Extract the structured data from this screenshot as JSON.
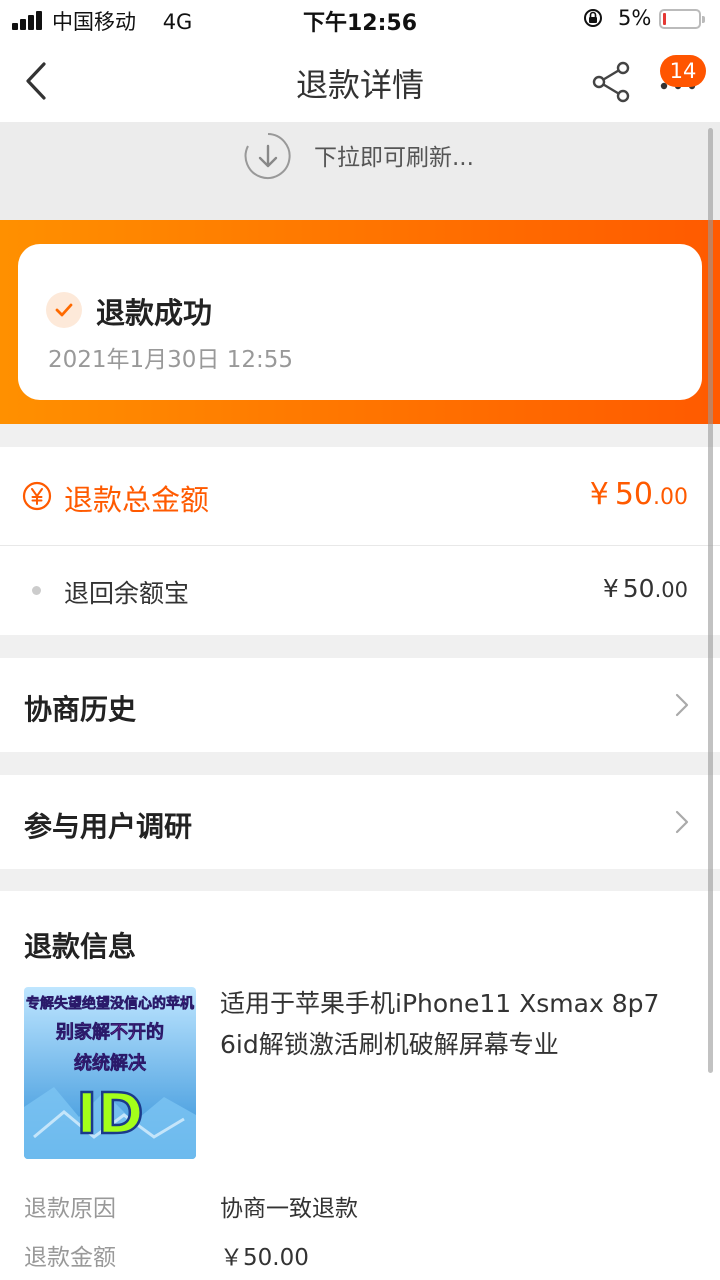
{
  "status_bar": {
    "carrier": "中国移动",
    "network": "4G",
    "time": "下午12:56",
    "battery_percent": "5%",
    "battery_level": 0.05
  },
  "nav": {
    "title": "退款详情",
    "badge_count": "14",
    "icons": [
      "back-icon",
      "share-icon",
      "more-icon"
    ]
  },
  "refresh": {
    "hint": "下拉即可刷新..."
  },
  "status_card": {
    "title": "退款成功",
    "time": "2021年1月30日 12:55"
  },
  "amount": {
    "total_label": "退款总金额",
    "total_currency": "¥",
    "total_int": "50",
    "total_dec": ".00",
    "sub_label": "退回余额宝",
    "sub_currency": "¥",
    "sub_int": "50",
    "sub_dec": ".00"
  },
  "links": [
    {
      "label": "协商历史"
    },
    {
      "label": "参与用户调研"
    }
  ],
  "refund_info": {
    "title": "退款信息",
    "product_image_text": [
      "专解失望绝望没信心的苹机",
      "别家解不开的",
      "统统解决",
      "ID"
    ],
    "product_title": "适用于苹果手机iPhone11 Xsmax 8p7 6id解锁激活刷机破解屏幕专业",
    "rows": [
      {
        "label": "退款原因",
        "value": "协商一致退款"
      },
      {
        "label": "退款金额",
        "value": "￥50.00"
      }
    ]
  },
  "colors": {
    "accent": "#ff5a00",
    "hero_gradient_start": "#ff9000",
    "hero_gradient_end": "#ff5a00",
    "badge": "#ff5500"
  }
}
